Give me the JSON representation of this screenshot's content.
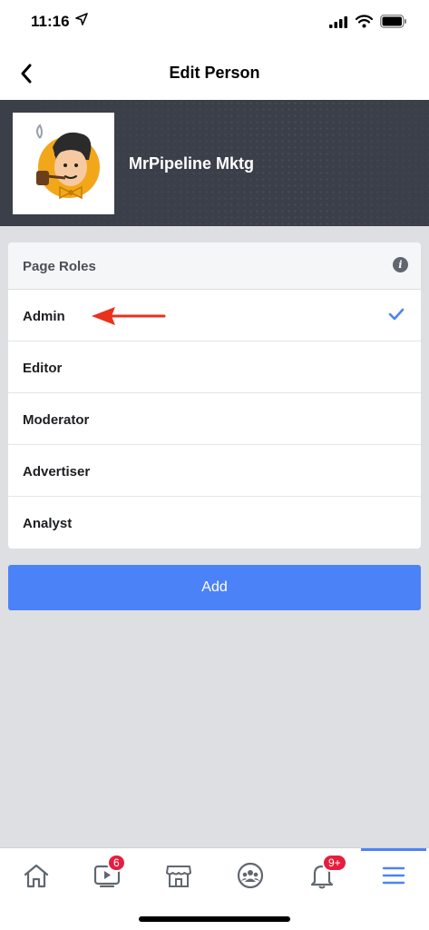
{
  "status_bar": {
    "time": "11:16"
  },
  "nav": {
    "title": "Edit Person"
  },
  "profile": {
    "name": "MrPipeline Mktg"
  },
  "roles": {
    "header": "Page Roles",
    "items": [
      {
        "label": "Admin",
        "selected": true
      },
      {
        "label": "Editor",
        "selected": false
      },
      {
        "label": "Moderator",
        "selected": false
      },
      {
        "label": "Advertiser",
        "selected": false
      },
      {
        "label": "Analyst",
        "selected": false
      }
    ]
  },
  "add_button": {
    "label": "Add"
  },
  "tab_bar": {
    "tabs": [
      {
        "icon": "home-icon",
        "badge": ""
      },
      {
        "icon": "video-icon",
        "badge": "6"
      },
      {
        "icon": "marketplace-icon",
        "badge": ""
      },
      {
        "icon": "groups-icon",
        "badge": ""
      },
      {
        "icon": "bell-icon",
        "badge": "9+"
      },
      {
        "icon": "menu-icon",
        "badge": "",
        "active": true
      }
    ]
  },
  "colors": {
    "accent": "#4c82f7",
    "badge": "#e41e3f",
    "annotation_arrow": "#e8321d"
  }
}
